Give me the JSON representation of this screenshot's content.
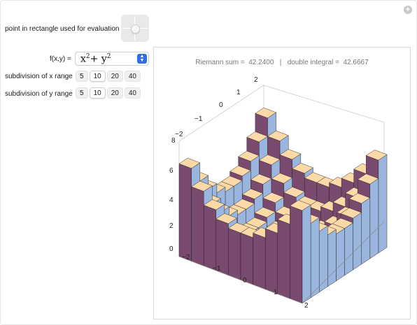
{
  "corner_button": "+",
  "controls": {
    "point_label": "point in rectangle used for evaluation",
    "f_label": "f(x,y) =",
    "f_value_base": "x",
    "f_value_sup1": "2",
    "f_value_plus": "+ y",
    "f_value_sup2": "2",
    "x_sub_label": "subdivision of x range",
    "y_sub_label": "subdivision of y range",
    "x_options": [
      "5",
      "10",
      "20",
      "40"
    ],
    "x_selected": "10",
    "y_options": [
      "5",
      "10",
      "20",
      "40"
    ],
    "y_selected": "10"
  },
  "plot": {
    "riemann_label": "Riemann sum =",
    "riemann_value": "42.2400",
    "separator": "|",
    "integral_label": "double integral =",
    "integral_value": "42.6667",
    "z_ticks": [
      "0",
      "2",
      "4",
      "6",
      "8"
    ],
    "front_x_ticks": [
      "−2",
      "−1",
      "0",
      "1",
      "2"
    ],
    "back_y_ticks": [
      "2",
      "1",
      "0",
      "−1",
      "−2"
    ]
  },
  "colors": {
    "bar_top": "#fcd9a7",
    "bar_left": "#7a4a6e",
    "bar_right": "#9bb6de",
    "accent": "#2f6fe0"
  }
}
